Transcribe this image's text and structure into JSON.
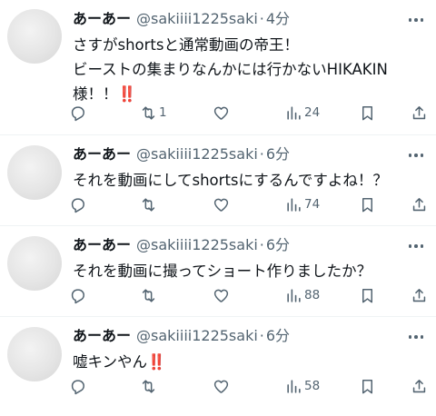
{
  "tweets": [
    {
      "name": "あーあー",
      "handle": "@sakiiii1225saki",
      "separator": "·",
      "time": "4分",
      "lines": [
        "さすがshortsと通常動画の帝王！",
        "ビーストの集まりなんかには行かないHIKAKIN",
        "様！！"
      ],
      "emoji": "‼️",
      "retweets": "1",
      "views": "24"
    },
    {
      "name": "あーあー",
      "handle": "@sakiiii1225saki",
      "separator": "·",
      "time": "6分",
      "lines": [
        "それを動画にしてshortsにするんですよね！？"
      ],
      "views": "74"
    },
    {
      "name": "あーあー",
      "handle": "@sakiiii1225saki",
      "separator": "·",
      "time": "6分",
      "lines": [
        "それを動画に撮ってショート作りましたか？"
      ],
      "views": "88"
    },
    {
      "name": "あーあー",
      "handle": "@sakiiii1225saki",
      "separator": "·",
      "time": "6分",
      "lines": [
        "嘘キンやん"
      ],
      "emoji": "‼️",
      "views": "58"
    }
  ],
  "icons": [
    "more-icon",
    "reply-icon",
    "retweet-icon",
    "like-icon",
    "views-icon",
    "bookmark-icon",
    "share-icon"
  ]
}
